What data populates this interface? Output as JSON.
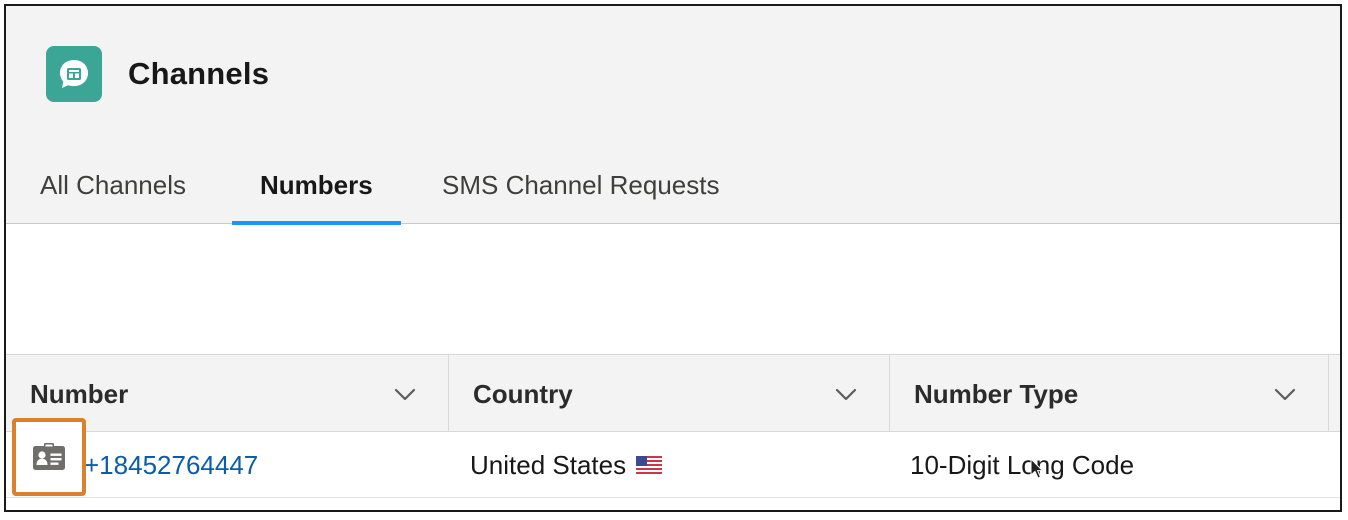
{
  "page": {
    "title": "Channels"
  },
  "tabs": [
    {
      "label": "All Channels",
      "active": false
    },
    {
      "label": "Numbers",
      "active": true
    },
    {
      "label": "SMS Channel Requests",
      "active": false
    }
  ],
  "table": {
    "columns": [
      {
        "label": "Number"
      },
      {
        "label": "Country"
      },
      {
        "label": "Number Type"
      }
    ],
    "rows": [
      {
        "number": "+18452764447",
        "country": "United States",
        "country_flag": "us-flag-icon",
        "number_type": "10-Digit Long Code"
      }
    ]
  },
  "icons": {
    "app": "chat-channel-icon",
    "record": "contact-card-icon",
    "sort": "chevron-down-icon"
  },
  "colors": {
    "app_icon_bg": "#3ba596",
    "active_tab_underline": "#1b96ff",
    "link": "#0b5cab",
    "highlight_box": "#d9822b"
  }
}
